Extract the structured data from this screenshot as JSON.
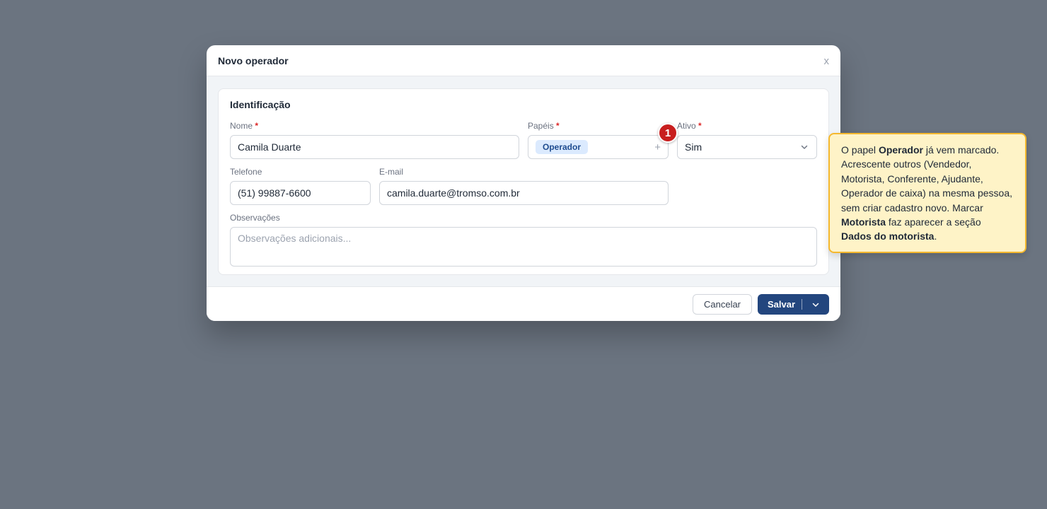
{
  "modal": {
    "title": "Novo operador",
    "close_label": "x"
  },
  "section": {
    "title": "Identificação"
  },
  "fields": {
    "nome": {
      "label": "Nome",
      "value": "Camila Duarte",
      "required": "*"
    },
    "papeis": {
      "label": "Papéis",
      "chip": "Operador",
      "add_label": "+",
      "required": "*"
    },
    "ativo": {
      "label": "Ativo",
      "value": "Sim",
      "required": "*"
    },
    "telefone": {
      "label": "Telefone",
      "value": "(51) 99887-6600"
    },
    "email": {
      "label": "E-mail",
      "value": "camila.duarte@tromso.com.br"
    },
    "observacoes": {
      "label": "Observações",
      "placeholder": "Observações adicionais..."
    }
  },
  "footer": {
    "cancel_label": "Cancelar",
    "save_label": "Salvar"
  },
  "tour": {
    "step_number": "1",
    "tooltip": {
      "p1": "O papel ",
      "b1": "Operador",
      "p2": " já vem marcado. Acrescente outros (Vendedor, Motorista, Conferente, Ajudante, Operador de caixa) na mesma pessoa, sem criar cadastro novo. Marcar ",
      "b2": "Motorista",
      "p3": " faz aparecer a seção ",
      "b3": "Dados do motorista",
      "p4": "."
    }
  },
  "colors": {
    "overlay": "#6b7480",
    "primary": "#23467e",
    "required": "#dc2626",
    "chip_bg": "#dbeafe",
    "badge": "#c81e1e",
    "tooltip_bg": "#fef3c7",
    "tooltip_border": "#f5b82e"
  },
  "icons": {
    "close": "close-icon",
    "select_caret": "chevron-down-icon",
    "save_dropdown": "chevron-down-icon",
    "add_role": "plus-icon"
  }
}
